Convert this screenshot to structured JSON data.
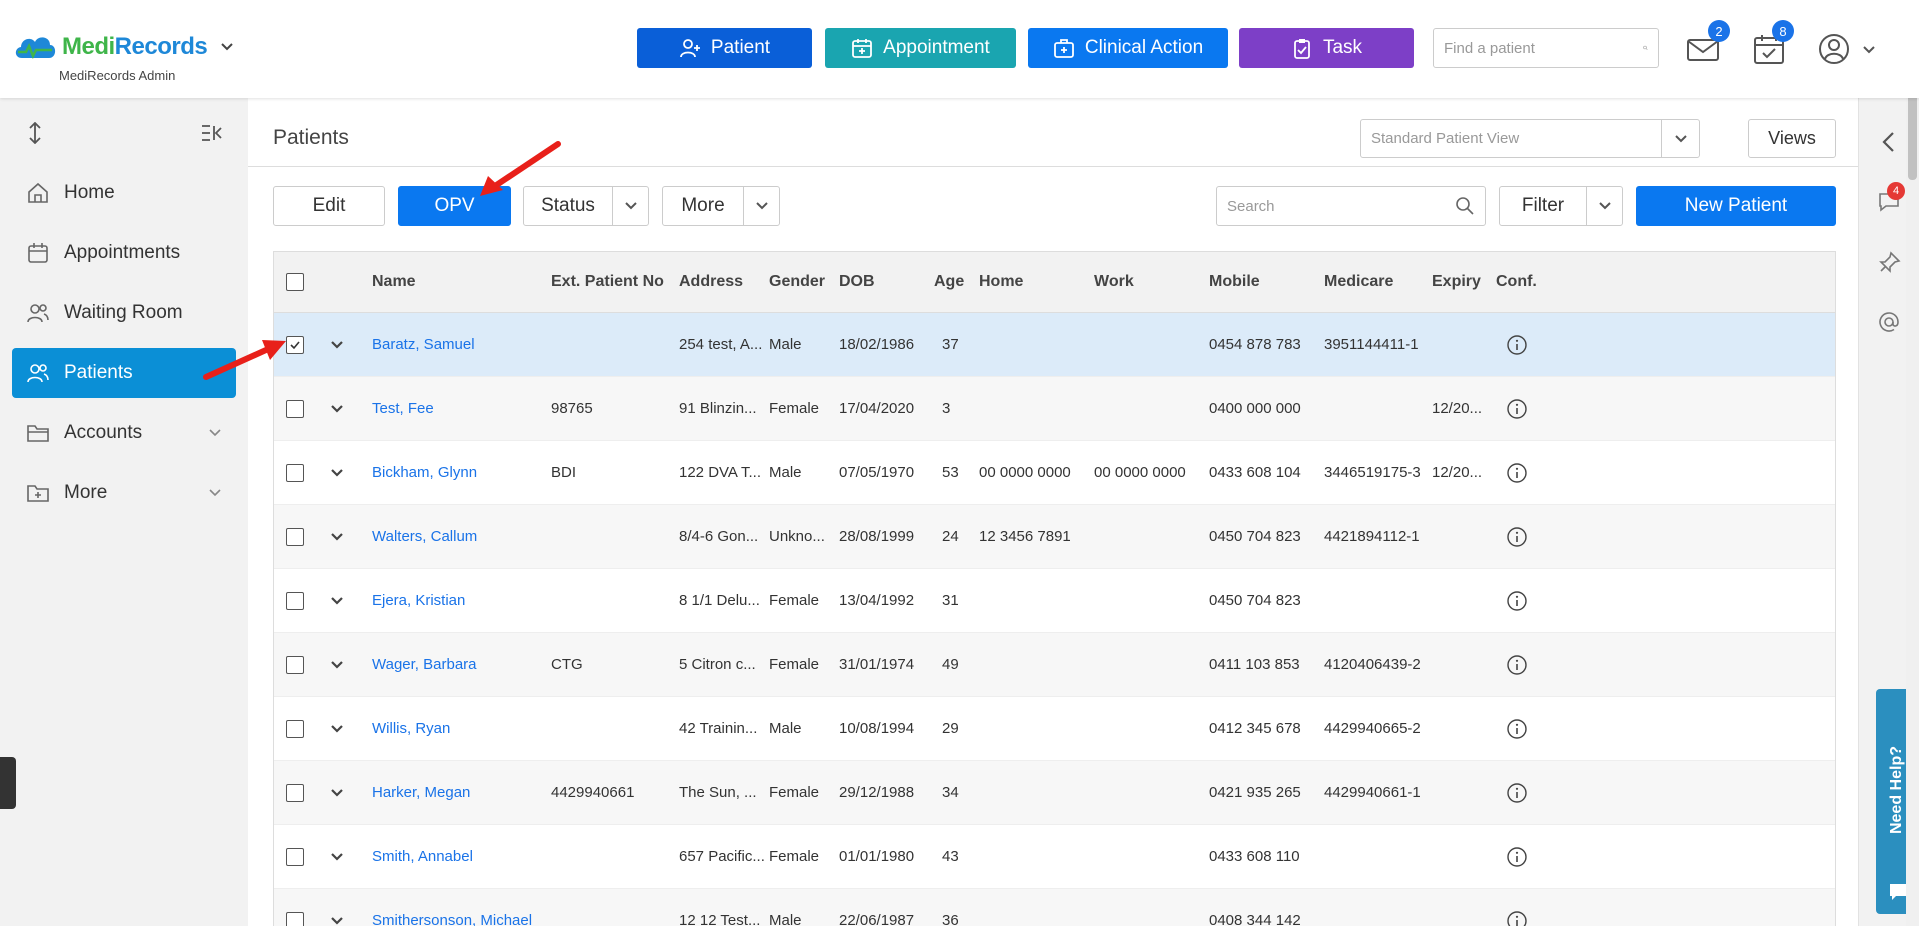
{
  "brand": {
    "medi": "Medi",
    "records": "Records",
    "subtitle": "MediRecords Admin"
  },
  "header_buttons": {
    "patient": "Patient",
    "appointment": "Appointment",
    "clinical_action": "Clinical Action",
    "task": "Task"
  },
  "colors": {
    "patient": "#0a5fd8",
    "appointment": "#1aa5b0",
    "clinical": "#0a78f0",
    "task": "#7d3fc7",
    "active_nav": "#0b8fd6"
  },
  "find_patient": {
    "placeholder": "Find a patient"
  },
  "notifications": {
    "mail_count": "2",
    "calendar_count": "8",
    "chat_count": "4"
  },
  "sidebar": {
    "items": [
      {
        "label": "Home",
        "icon": "home-icon"
      },
      {
        "label": "Appointments",
        "icon": "calendar-icon"
      },
      {
        "label": "Waiting Room",
        "icon": "people-icon"
      },
      {
        "label": "Patients",
        "icon": "patients-icon",
        "active": true
      },
      {
        "label": "Accounts",
        "icon": "folder-icon"
      },
      {
        "label": "More",
        "icon": "folder-plus-icon"
      }
    ]
  },
  "page": {
    "title": "Patients",
    "view_select": "Standard Patient View",
    "views_label": "Views"
  },
  "toolbar": {
    "edit": "Edit",
    "opv": "OPV",
    "status": "Status",
    "more": "More",
    "search_placeholder": "Search",
    "filter": "Filter",
    "new_patient": "New Patient"
  },
  "table": {
    "headers": {
      "name": "Name",
      "ext": "Ext. Patient No",
      "address": "Address",
      "gender": "Gender",
      "dob": "DOB",
      "age": "Age",
      "home": "Home",
      "work": "Work",
      "mobile": "Mobile",
      "medicare": "Medicare",
      "expiry": "Expiry",
      "conf": "Conf."
    },
    "rows": [
      {
        "name": "Baratz, Samuel",
        "ext": "",
        "address": "254 test, A...",
        "gender": "Male",
        "dob": "18/02/1986",
        "age": "37",
        "home": "",
        "work": "",
        "mobile": "0454 878 783",
        "medicare": "3951144411-1",
        "expiry": "",
        "checked": true
      },
      {
        "name": "Test, Fee",
        "ext": "98765",
        "address": "91 Blinzin...",
        "gender": "Female",
        "dob": "17/04/2020",
        "age": "3",
        "home": "",
        "work": "",
        "mobile": "0400 000 000",
        "medicare": "",
        "expiry": "12/20..."
      },
      {
        "name": "Bickham, Glynn",
        "ext": "BDI",
        "address": "122 DVA T...",
        "gender": "Male",
        "dob": "07/05/1970",
        "age": "53",
        "home": "00 0000 0000",
        "work": "00 0000 0000",
        "mobile": "0433 608 104",
        "medicare": "3446519175-3",
        "expiry": "12/20..."
      },
      {
        "name": "Walters, Callum",
        "ext": "",
        "address": "8/4-6 Gon...",
        "gender": "Unkno...",
        "dob": "28/08/1999",
        "age": "24",
        "home": "12 3456 7891",
        "work": "",
        "mobile": "0450 704 823",
        "medicare": "4421894112-1",
        "expiry": ""
      },
      {
        "name": "Ejera, Kristian",
        "ext": "",
        "address": "8 1/1 Delu...",
        "gender": "Female",
        "dob": "13/04/1992",
        "age": "31",
        "home": "",
        "work": "",
        "mobile": "0450 704 823",
        "medicare": "",
        "expiry": ""
      },
      {
        "name": "Wager, Barbara",
        "ext": "CTG",
        "address": "5 Citron c...",
        "gender": "Female",
        "dob": "31/01/1974",
        "age": "49",
        "home": "",
        "work": "",
        "mobile": "0411 103 853",
        "medicare": "4120406439-2",
        "expiry": ""
      },
      {
        "name": "Willis, Ryan",
        "ext": "",
        "address": "42 Trainin...",
        "gender": "Male",
        "dob": "10/08/1994",
        "age": "29",
        "home": "",
        "work": "",
        "mobile": "0412 345 678",
        "medicare": "4429940665-2",
        "expiry": ""
      },
      {
        "name": "Harker, Megan",
        "ext": "4429940661",
        "address": "The Sun, ...",
        "gender": "Female",
        "dob": "29/12/1988",
        "age": "34",
        "home": "",
        "work": "",
        "mobile": "0421 935 265",
        "medicare": "4429940661-1",
        "expiry": ""
      },
      {
        "name": "Smith, Annabel",
        "ext": "",
        "address": "657 Pacific...",
        "gender": "Female",
        "dob": "01/01/1980",
        "age": "43",
        "home": "",
        "work": "",
        "mobile": "0433 608 110",
        "medicare": "",
        "expiry": ""
      },
      {
        "name": "Smithersonson, Michael",
        "ext": "",
        "address": "12 12 Test...",
        "gender": "Male",
        "dob": "22/06/1987",
        "age": "36",
        "home": "",
        "work": "",
        "mobile": "0408 344 142",
        "medicare": "",
        "expiry": ""
      }
    ]
  },
  "help": {
    "label": "Need Help?"
  }
}
